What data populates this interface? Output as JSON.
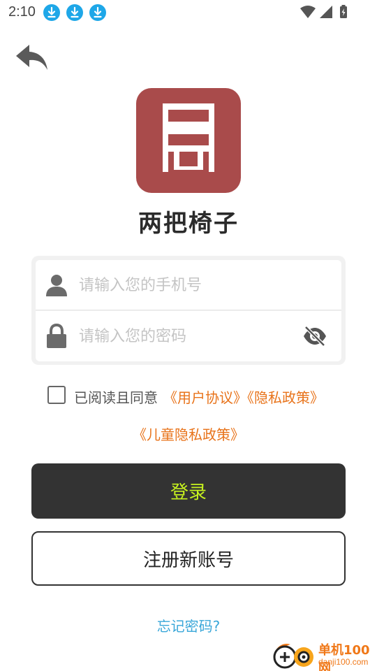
{
  "status_bar": {
    "time": "2:10",
    "download_icon_count": 3
  },
  "app": {
    "name": "两把椅子",
    "logo_color": "#a94b4b"
  },
  "form": {
    "phone_placeholder": "请输入您的手机号",
    "phone_value": "",
    "password_placeholder": "请输入您的密码",
    "password_value": ""
  },
  "agreement": {
    "checked": false,
    "prefix": "已阅读且同意",
    "user_agreement": "《用户协议》",
    "privacy_policy": "《隐私政策》",
    "child_privacy_policy": "《儿童隐私政策》"
  },
  "buttons": {
    "login": "登录",
    "register": "注册新账号"
  },
  "forgot_password": "忘记密码?",
  "watermark": {
    "line1": "单机100网",
    "line2": "danji100.com"
  },
  "colors": {
    "accent_orange": "#e8731a",
    "login_bg": "#333333",
    "login_text": "#c6f11f",
    "link_blue": "#3aa7d9",
    "download_icon": "#1ea7e8"
  }
}
